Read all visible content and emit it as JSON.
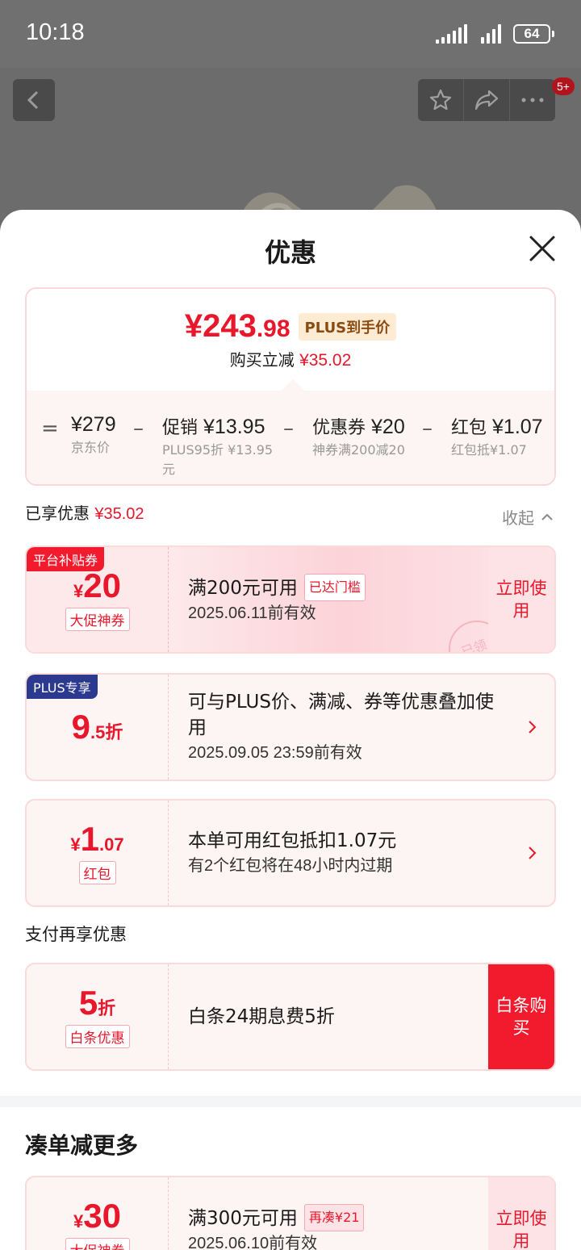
{
  "status_bar": {
    "time": "10:18",
    "battery": "64"
  },
  "top_nav": {
    "badge": "5+"
  },
  "sheet": {
    "title": "优惠",
    "summary": {
      "price_int": "¥243",
      "price_dec": ".98",
      "price_tag": "PLUS到手价",
      "reduce_label": "购买立减",
      "reduce_value": "¥35.02",
      "equals": "=",
      "breakdown": [
        {
          "main_label": "",
          "main_value": "¥279",
          "note": "京东价"
        },
        {
          "main_label": "促销",
          "main_value": "¥13.95",
          "note": "PLUS95折 ¥13.95元"
        },
        {
          "main_label": "优惠券",
          "main_value": "¥20",
          "note": "神券满200减20"
        },
        {
          "main_label": "红包",
          "main_value": "¥1.07",
          "note": "红包抵¥1.07"
        }
      ],
      "minus": "–"
    },
    "enjoyed": {
      "label": "已享优惠",
      "value": "¥35.02"
    },
    "collapse_label": "收起",
    "cards": [
      {
        "corner": "平台补贴券",
        "currency": "¥",
        "big": "20",
        "small": "",
        "tag": "大促神券",
        "title": "满200元可用",
        "pill": "已达门槛",
        "subtitle": "2025.06.11前有效",
        "action": "立即使用",
        "stamp": "已领"
      },
      {
        "corner": "PLUS专享",
        "currency": "",
        "big": "9",
        "small": ".5折",
        "tag": "",
        "title": "可与PLUS价、满减、券等优惠叠加使用",
        "subtitle": "2025.09.05 23:59前有效"
      },
      {
        "currency": "¥",
        "big": "1",
        "small": ".07",
        "tag": "红包",
        "title": "本单可用红包抵扣1.07元",
        "subtitle": "有2个红包将在48小时内过期"
      }
    ],
    "pay_section_label": "支付再享优惠",
    "pay_card": {
      "big": "5",
      "small": "折",
      "tag": "白条优惠",
      "title": "白条24期息费5折",
      "action": "白条购买"
    },
    "more_section": {
      "title": "凑单减更多",
      "card": {
        "currency": "¥",
        "big": "30",
        "tag": "大促神券",
        "title": "满300元可用",
        "pill": "再凑¥21",
        "subtitle": "2025.06.10前有效",
        "action": "立即使用"
      }
    }
  },
  "colors": {
    "brand_red": "#e8172b",
    "plus_navy": "#2b3a8f",
    "gold_tag_bg": "#fdebd4"
  }
}
